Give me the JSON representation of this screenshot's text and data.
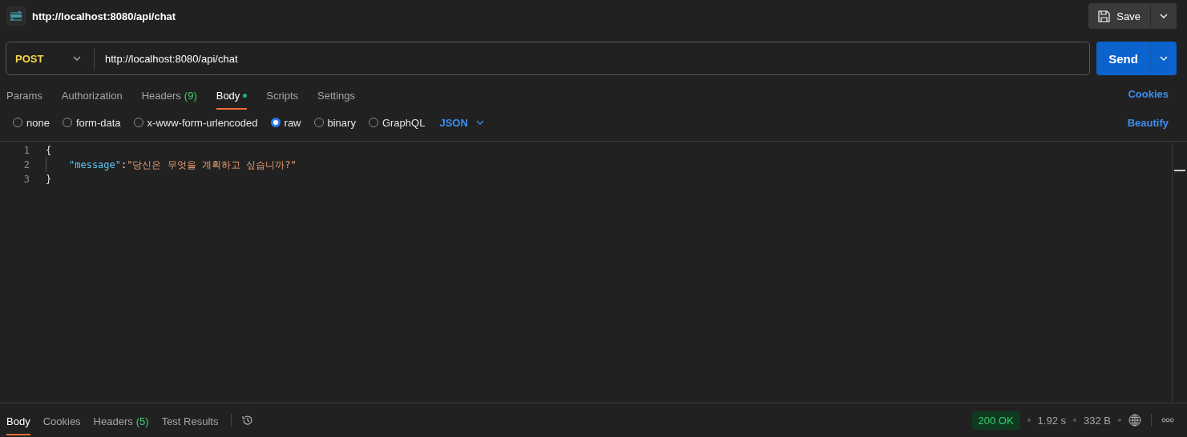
{
  "header": {
    "title": "http://localhost:8080/api/chat",
    "save_label": "Save"
  },
  "request": {
    "method": "POST",
    "url": "http://localhost:8080/api/chat",
    "send_label": "Send"
  },
  "request_tabs": [
    {
      "label": "Params",
      "selected": false,
      "dot": false
    },
    {
      "label": "Authorization",
      "selected": false,
      "dot": false
    },
    {
      "label": "Headers",
      "count": "(9)",
      "selected": false,
      "dot": false
    },
    {
      "label": "Body",
      "selected": true,
      "dot": true
    },
    {
      "label": "Scripts",
      "selected": false,
      "dot": false
    },
    {
      "label": "Settings",
      "selected": false,
      "dot": false
    }
  ],
  "cookies_link": "Cookies",
  "body_types": [
    {
      "label": "none",
      "selected": false
    },
    {
      "label": "form-data",
      "selected": false
    },
    {
      "label": "x-www-form-urlencoded",
      "selected": false
    },
    {
      "label": "raw",
      "selected": true
    },
    {
      "label": "binary",
      "selected": false
    },
    {
      "label": "GraphQL",
      "selected": false
    }
  ],
  "body_format": "JSON",
  "beautify_link": "Beautify",
  "editor_lines": [
    {
      "number": "1",
      "tokens": [
        {
          "kind": "punct",
          "text": "{"
        }
      ]
    },
    {
      "number": "2",
      "indent": true,
      "tokens": [
        {
          "kind": "key",
          "text": "\"message\""
        },
        {
          "kind": "punct",
          "text": ":"
        },
        {
          "kind": "string",
          "text": "\"당신은 무엇을 계획하고 싶습니까?\""
        }
      ]
    },
    {
      "number": "3",
      "tokens": [
        {
          "kind": "punct",
          "text": "}"
        }
      ]
    }
  ],
  "response_tabs": [
    {
      "label": "Body",
      "selected": true
    },
    {
      "label": "Cookies",
      "selected": false
    },
    {
      "label": "Headers",
      "count": "(5)",
      "selected": false
    },
    {
      "label": "Test Results",
      "selected": false
    }
  ],
  "response_status": {
    "status": "200 OK",
    "time": "1.92 s",
    "size": "332 B"
  }
}
